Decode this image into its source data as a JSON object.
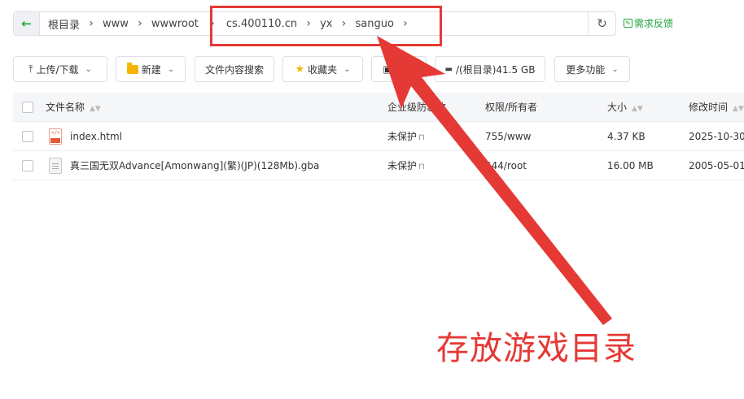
{
  "pathbar": {
    "crumbs": [
      "根目录",
      "www",
      "wwwroot",
      "cs.400110.cn",
      "yx",
      "sanguo"
    ],
    "separator": "›",
    "feedback_label": "需求反馈"
  },
  "toolbar": {
    "upload_download": "上传/下载",
    "new": "新建",
    "content_search": "文件内容搜索",
    "favorites": "收藏夹",
    "terminal": "终端",
    "disk": "/(根目录)41.5 GB",
    "more": "更多功能"
  },
  "table": {
    "headers": {
      "name": "文件名称",
      "protection": "企业级防篡改",
      "permission": "权限/所有者",
      "size": "大小",
      "modified": "修改时间"
    },
    "rows": [
      {
        "name": "index.html",
        "protection": "未保护",
        "permission": "755/www",
        "size": "4.37 KB",
        "modified": "2025-10-30"
      },
      {
        "name": "真三国无双Advance[Amonwang](繁)(JP)(128Mb).gba",
        "protection": "未保护",
        "permission": "644/root",
        "size": "16.00 MB",
        "modified": "2005-05-01"
      }
    ]
  },
  "annotation": {
    "text": "存放游戏目录",
    "color": "#e53935"
  },
  "colors": {
    "accent": "#20a53a",
    "annotation_red": "#e53935"
  }
}
